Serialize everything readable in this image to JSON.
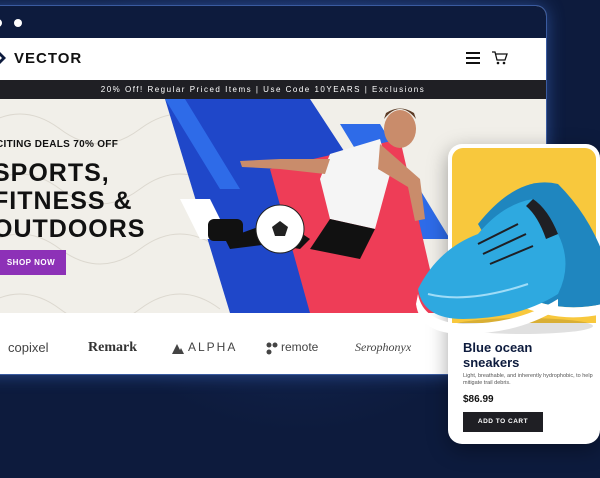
{
  "site": {
    "brand_name": "VECTOR",
    "promo_banner": "20% Off! Regular Priced Items | Use Code 10YEARS | Exclusions"
  },
  "hero": {
    "eyebrow": "CITING DEALS 70% OFF",
    "headline": "SPORTS,\nFITNESS &\nOUTDOORS",
    "cta_label": "SHOP NOW"
  },
  "brands": [
    "copixel",
    "Remark",
    "ALPHA",
    "remote",
    "Serophonyx"
  ],
  "product": {
    "title": "Blue ocean\nsneakers",
    "description": "Light, breathable, and inherently hydrophobic, to help mitigate trail debris.",
    "price": "$86.99",
    "cta_label": "ADD TO CART"
  },
  "colors": {
    "background": "#0d1b3d",
    "promo_bar": "#1f1f24",
    "shop_button": "#8d31b7",
    "card_accent": "#f8c83d",
    "hero_blue": "#1f47c9",
    "hero_red": "#ee3d57",
    "shoe": "#2ea9e0"
  },
  "icons": [
    "menu-icon",
    "cart-icon",
    "logo-mark-icon"
  ]
}
